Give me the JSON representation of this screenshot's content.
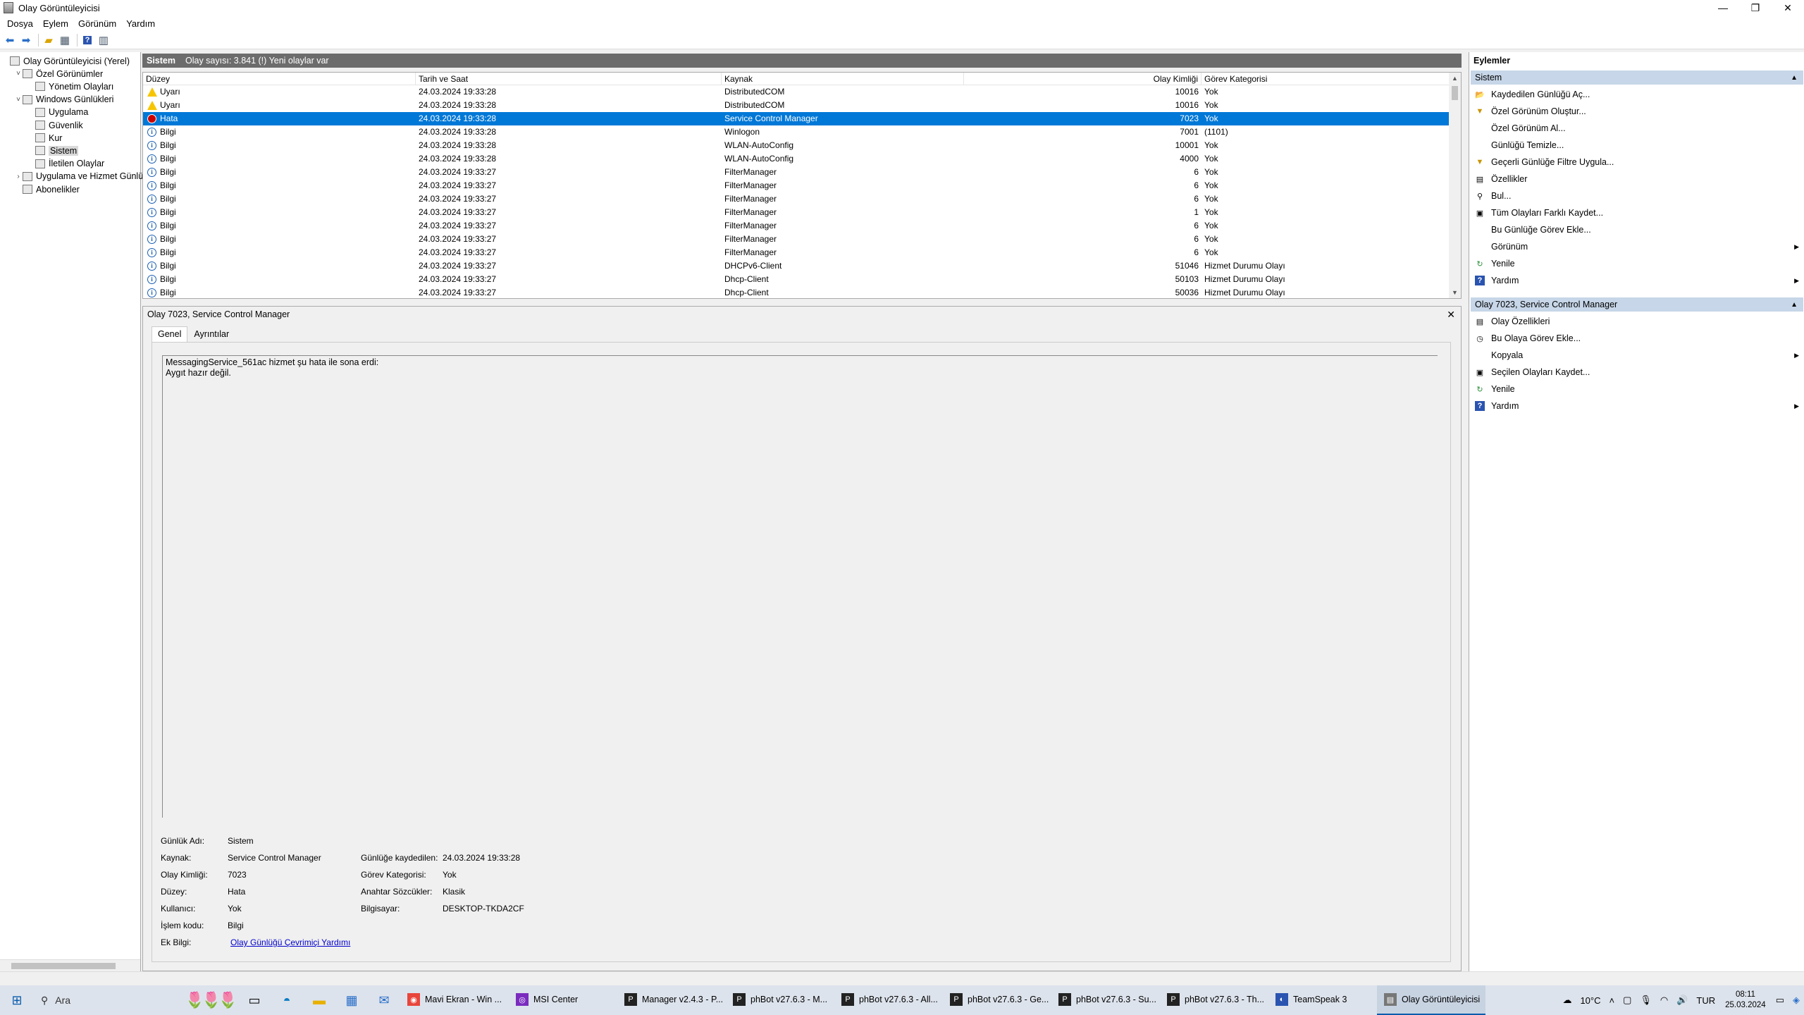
{
  "window": {
    "title": "Olay Görüntüleyicisi"
  },
  "menu": [
    "Dosya",
    "Eylem",
    "Görünüm",
    "Yardım"
  ],
  "toolbar_icons": [
    "back-icon",
    "forward-icon",
    "up-folder-icon",
    "show-hide-tree-icon",
    "help-icon",
    "show-hide-actions-icon"
  ],
  "tree": [
    {
      "label": "Olay Görüntüleyicisi (Yerel)",
      "level": 0,
      "expander": ""
    },
    {
      "label": "Özel Görünümler",
      "level": 1,
      "expander": "˅"
    },
    {
      "label": "Yönetim Olayları",
      "level": 2,
      "expander": ""
    },
    {
      "label": "Windows Günlükleri",
      "level": 1,
      "expander": "˅"
    },
    {
      "label": "Uygulama",
      "level": 2,
      "expander": ""
    },
    {
      "label": "Güvenlik",
      "level": 2,
      "expander": ""
    },
    {
      "label": "Kur",
      "level": 2,
      "expander": ""
    },
    {
      "label": "Sistem",
      "level": 2,
      "expander": "",
      "selected": true
    },
    {
      "label": "İletilen Olaylar",
      "level": 2,
      "expander": ""
    },
    {
      "label": "Uygulama ve Hizmet Günlük",
      "level": 1,
      "expander": "›"
    },
    {
      "label": "Abonelikler",
      "level": 1,
      "expander": ""
    }
  ],
  "list_header": {
    "title": "Sistem",
    "info": "Olay sayısı: 3.841 (!) Yeni olaylar var"
  },
  "columns": [
    "Düzey",
    "Tarih ve Saat",
    "Kaynak",
    "Olay Kimliği",
    "Görev Kategorisi"
  ],
  "events": [
    {
      "level": "Uyarı",
      "type": "warn",
      "date": "24.03.2024 19:33:28",
      "source": "DistributedCOM",
      "id": "10016",
      "category": "Yok"
    },
    {
      "level": "Uyarı",
      "type": "warn",
      "date": "24.03.2024 19:33:28",
      "source": "DistributedCOM",
      "id": "10016",
      "category": "Yok"
    },
    {
      "level": "Hata",
      "type": "err",
      "date": "24.03.2024 19:33:28",
      "source": "Service Control Manager",
      "id": "7023",
      "category": "Yok",
      "selected": true
    },
    {
      "level": "Bilgi",
      "type": "info",
      "date": "24.03.2024 19:33:28",
      "source": "Winlogon",
      "id": "7001",
      "category": "(1101)"
    },
    {
      "level": "Bilgi",
      "type": "info",
      "date": "24.03.2024 19:33:28",
      "source": "WLAN-AutoConfig",
      "id": "10001",
      "category": "Yok"
    },
    {
      "level": "Bilgi",
      "type": "info",
      "date": "24.03.2024 19:33:28",
      "source": "WLAN-AutoConfig",
      "id": "4000",
      "category": "Yok"
    },
    {
      "level": "Bilgi",
      "type": "info",
      "date": "24.03.2024 19:33:27",
      "source": "FilterManager",
      "id": "6",
      "category": "Yok"
    },
    {
      "level": "Bilgi",
      "type": "info",
      "date": "24.03.2024 19:33:27",
      "source": "FilterManager",
      "id": "6",
      "category": "Yok"
    },
    {
      "level": "Bilgi",
      "type": "info",
      "date": "24.03.2024 19:33:27",
      "source": "FilterManager",
      "id": "6",
      "category": "Yok"
    },
    {
      "level": "Bilgi",
      "type": "info",
      "date": "24.03.2024 19:33:27",
      "source": "FilterManager",
      "id": "1",
      "category": "Yok"
    },
    {
      "level": "Bilgi",
      "type": "info",
      "date": "24.03.2024 19:33:27",
      "source": "FilterManager",
      "id": "6",
      "category": "Yok"
    },
    {
      "level": "Bilgi",
      "type": "info",
      "date": "24.03.2024 19:33:27",
      "source": "FilterManager",
      "id": "6",
      "category": "Yok"
    },
    {
      "level": "Bilgi",
      "type": "info",
      "date": "24.03.2024 19:33:27",
      "source": "FilterManager",
      "id": "6",
      "category": "Yok"
    },
    {
      "level": "Bilgi",
      "type": "info",
      "date": "24.03.2024 19:33:27",
      "source": "DHCPv6-Client",
      "id": "51046",
      "category": "Hizmet Durumu Olayı"
    },
    {
      "level": "Bilgi",
      "type": "info",
      "date": "24.03.2024 19:33:27",
      "source": "Dhcp-Client",
      "id": "50103",
      "category": "Hizmet Durumu Olayı"
    },
    {
      "level": "Bilgi",
      "type": "info",
      "date": "24.03.2024 19:33:27",
      "source": "Dhcp-Client",
      "id": "50036",
      "category": "Hizmet Durumu Olayı"
    }
  ],
  "detail": {
    "title": "Olay 7023, Service Control Manager",
    "tabs": [
      "Genel",
      "Ayrıntılar"
    ],
    "message": [
      "MessagingService_561ac hizmet şu hata ile sona erdi:",
      "Aygıt hazır değil."
    ],
    "props": {
      "log_name_label": "Günlük Adı:",
      "log_name": "Sistem",
      "source_label": "Kaynak:",
      "source": "Service Control Manager",
      "logged_label": "Günlüğe kaydedilen:",
      "logged": "24.03.2024 19:33:28",
      "event_id_label": "Olay Kimliği:",
      "event_id": "7023",
      "task_label": "Görev Kategorisi:",
      "task": "Yok",
      "level_label": "Düzey:",
      "level": "Hata",
      "keywords_label": "Anahtar Sözcükler:",
      "keywords": "Klasik",
      "user_label": "Kullanıcı:",
      "user": "Yok",
      "computer_label": "Bilgisayar:",
      "computer": "DESKTOP-TKDA2CF",
      "opcode_label": "İşlem kodu:",
      "opcode": "Bilgi",
      "more_label": "Ek Bilgi:",
      "more_link": "Olay Günlüğü Çevrimiçi Yardımı"
    }
  },
  "actions": {
    "title": "Eylemler",
    "section1": "Sistem",
    "items1": [
      {
        "label": "Kaydedilen Günlüğü Aç...",
        "icon": "open-log-icon",
        "glyph": "📂",
        "arrow": false
      },
      {
        "label": "Özel Görünüm Oluştur...",
        "icon": "filter-create-icon",
        "glyph": "▼",
        "arrow": false
      },
      {
        "label": "Özel Görünüm Al...",
        "icon": "",
        "glyph": "",
        "arrow": false
      },
      {
        "label": "Günlüğü Temizle...",
        "icon": "",
        "glyph": "",
        "arrow": false
      },
      {
        "label": "Geçerli Günlüğe Filtre Uygula...",
        "icon": "filter-icon",
        "glyph": "▼",
        "arrow": false
      },
      {
        "label": "Özellikler",
        "icon": "properties-icon",
        "glyph": "▤",
        "arrow": false
      },
      {
        "label": "Bul...",
        "icon": "find-icon",
        "glyph": "⚲",
        "arrow": false
      },
      {
        "label": "Tüm Olayları Farklı Kaydet...",
        "icon": "save-icon",
        "glyph": "▣",
        "arrow": false
      },
      {
        "label": "Bu Günlüğe Görev Ekle...",
        "icon": "",
        "glyph": "",
        "arrow": false
      },
      {
        "label": "Görünüm",
        "icon": "",
        "glyph": "",
        "arrow": true
      },
      {
        "label": "Yenile",
        "icon": "refresh-icon",
        "glyph": "↻",
        "arrow": false
      },
      {
        "label": "Yardım",
        "icon": "help-icon",
        "glyph": "?",
        "arrow": true
      }
    ],
    "section2": "Olay 7023, Service Control Manager",
    "items2": [
      {
        "label": "Olay Özellikleri",
        "icon": "event-properties-icon",
        "glyph": "▤",
        "arrow": false
      },
      {
        "label": "Bu Olaya Görev Ekle...",
        "icon": "task-icon",
        "glyph": "◷",
        "arrow": false
      },
      {
        "label": "Kopyala",
        "icon": "",
        "glyph": "",
        "arrow": true
      },
      {
        "label": "Seçilen Olayları Kaydet...",
        "icon": "save-icon",
        "glyph": "▣",
        "arrow": false
      },
      {
        "label": "Yenile",
        "icon": "refresh-icon",
        "glyph": "↻",
        "arrow": false
      },
      {
        "label": "Yardım",
        "icon": "help-icon",
        "glyph": "?",
        "arrow": true
      }
    ]
  },
  "taskbar": {
    "search": "Ara",
    "tasks": [
      {
        "label": "Mavi Ekran - Win ...",
        "icon": "chrome-icon",
        "glyph": "◉"
      },
      {
        "label": "MSI Center",
        "icon": "msi-icon",
        "glyph": "◎"
      },
      {
        "label": "Manager v2.4.3 - P...",
        "icon": "phbot-icon",
        "glyph": "P"
      },
      {
        "label": "phBot v27.6.3 - M...",
        "icon": "phbot-icon",
        "glyph": "P"
      },
      {
        "label": "phBot v27.6.3 - All...",
        "icon": "phbot-icon",
        "glyph": "P"
      },
      {
        "label": "phBot v27.6.3 - Ge...",
        "icon": "phbot-icon",
        "glyph": "P"
      },
      {
        "label": "phBot v27.6.3 - Su...",
        "icon": "phbot-icon",
        "glyph": "P"
      },
      {
        "label": "phBot v27.6.3 - Th...",
        "icon": "phbot-icon",
        "glyph": "P"
      },
      {
        "label": "TeamSpeak 3",
        "icon": "teamspeak-icon",
        "glyph": "◐"
      },
      {
        "label": "Olay Görüntüleyicisi",
        "icon": "event-viewer-icon",
        "glyph": "▤",
        "active": true
      }
    ],
    "weather": "10°C",
    "lang": "TUR",
    "time": "08:11",
    "date": "25.03.2024"
  }
}
